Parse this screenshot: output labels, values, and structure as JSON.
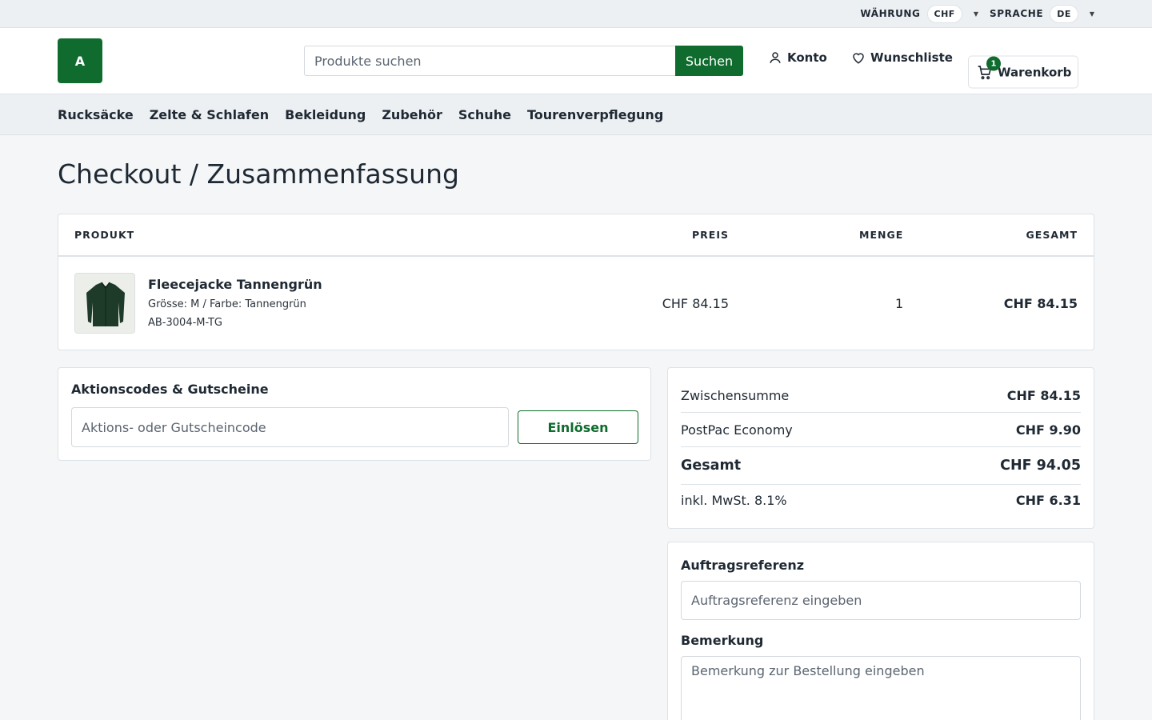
{
  "topbar": {
    "currency_label": "WÄHRUNG",
    "currency_value": "CHF",
    "language_label": "SPRACHE",
    "language_value": "DE"
  },
  "header": {
    "logo_text": "A",
    "search_placeholder": "Produkte suchen",
    "search_button": "Suchen",
    "account": "Konto",
    "wishlist": "Wunschliste",
    "cart": "Warenkorb",
    "cart_count": "1"
  },
  "nav": {
    "items": [
      "Rucksäcke",
      "Zelte & Schlafen",
      "Bekleidung",
      "Zubehör",
      "Schuhe",
      "Tourenverpflegung"
    ]
  },
  "page": {
    "title": "Checkout / Zusammenfassung"
  },
  "table": {
    "headers": {
      "product": "PRODUKT",
      "price": "PREIS",
      "qty": "MENGE",
      "total": "GESAMT"
    },
    "rows": [
      {
        "name": "Fleecejacke Tannengrün",
        "meta": "Grösse: M / Farbe: Tannengrün",
        "sku": "AB-3004-M-TG",
        "price": "CHF 84.15",
        "qty": "1",
        "total": "CHF 84.15"
      }
    ]
  },
  "coupon": {
    "title": "Aktionscodes & Gutscheine",
    "placeholder": "Aktions- oder Gutscheincode",
    "button": "Einlösen"
  },
  "summary": {
    "subtotal_label": "Zwischensumme",
    "subtotal_value": "CHF 84.15",
    "shipping_label": "PostPac Economy",
    "shipping_value": "CHF 9.90",
    "total_label": "Gesamt",
    "total_value": "CHF 94.05",
    "vat_label": "inkl. MwSt. 8.1%",
    "vat_value": "CHF 6.31"
  },
  "reference": {
    "order_ref_label": "Auftragsreferenz",
    "order_ref_placeholder": "Auftragsreferenz eingeben",
    "remark_label": "Bemerkung",
    "remark_placeholder": "Bemerkung zur Bestellung eingeben"
  },
  "colors": {
    "brand": "#0f6b2e",
    "background": "#f4f6f8",
    "border": "#dde2e7"
  },
  "icons": [
    "chevron-down-icon",
    "user-icon",
    "heart-icon",
    "cart-icon"
  ]
}
